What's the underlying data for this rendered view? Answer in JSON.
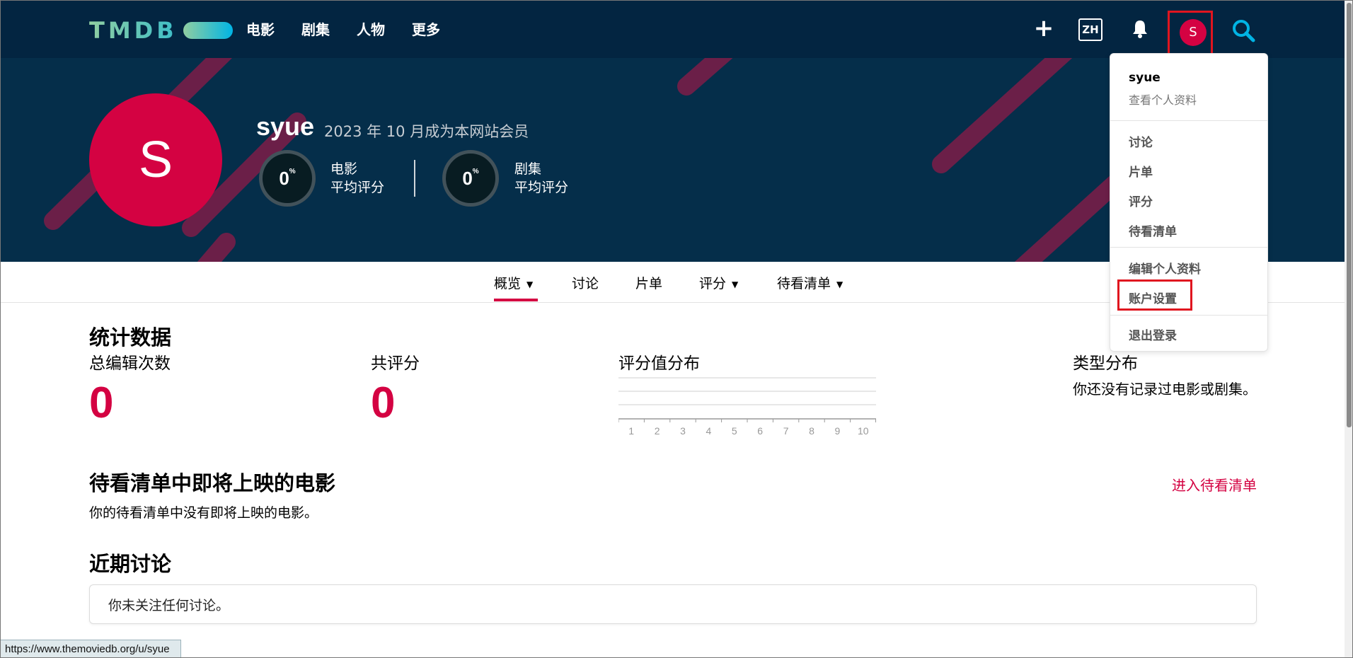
{
  "nav": {
    "logo_text": "TMDB",
    "items": [
      "电影",
      "剧集",
      "人物",
      "更多"
    ],
    "add_icon": "plus-icon",
    "lang": "ZH",
    "bell_icon": "bell-icon",
    "avatar_initial": "S",
    "search_icon": "search-icon"
  },
  "hero": {
    "avatar_initial": "S",
    "username": "syue",
    "member_since": "2023 年 10 月成为本网站会员",
    "movie_score": "0",
    "movie_label_1": "电影",
    "movie_label_2": "平均评分",
    "tv_score": "0",
    "tv_label_1": "剧集",
    "tv_label_2": "平均评分",
    "pct_sign": "%"
  },
  "tabs": [
    {
      "label": "概览",
      "caret": "▼"
    },
    {
      "label": "讨论"
    },
    {
      "label": "片单"
    },
    {
      "label": "评分",
      "caret": "▼"
    },
    {
      "label": "待看清单",
      "caret": "▼"
    }
  ],
  "dropdown": {
    "username": "syue",
    "view_profile": "查看个人资料",
    "items_group1": [
      "讨论",
      "片单",
      "评分",
      "待看清单"
    ],
    "edit_profile": "编辑个人资料",
    "account_settings": "账户设置",
    "logout": "退出登录"
  },
  "stats": {
    "title": "统计数据",
    "total_edits_label": "总编辑次数",
    "total_edits_value": "0",
    "total_ratings_label": "共评分",
    "total_ratings_value": "0",
    "rating_dist_label": "评分值分布",
    "genre_dist_label": "类型分布",
    "genre_empty": "你还没有记录过电影或剧集。"
  },
  "chart_data": {
    "type": "bar",
    "categories": [
      "1",
      "2",
      "3",
      "4",
      "5",
      "6",
      "7",
      "8",
      "9",
      "10"
    ],
    "values": [
      0,
      0,
      0,
      0,
      0,
      0,
      0,
      0,
      0,
      0
    ],
    "title": "评分值分布",
    "grid": true
  },
  "watchlist": {
    "title": "待看清单中即将上映的电影",
    "link": "进入待看清单",
    "empty": "你的待看清单中没有即将上映的电影。"
  },
  "discussions": {
    "title": "近期讨论",
    "empty": "你未关注任何讨论。"
  },
  "status_url": "https://www.themoviedb.org/u/syue",
  "colors": {
    "brand_pink": "#d40242",
    "nav_bg": "#032541",
    "highlight_red": "#e0151f"
  }
}
